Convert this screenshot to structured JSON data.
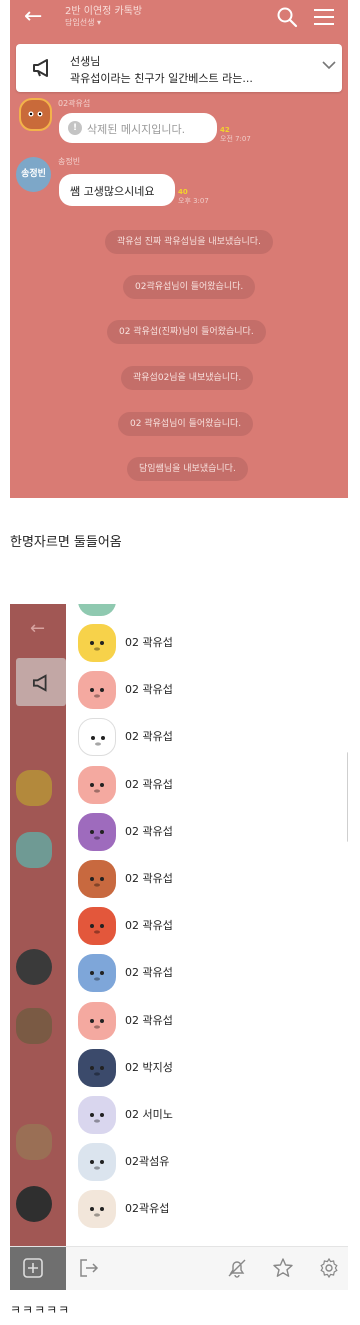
{
  "chat": {
    "title": "2반 이연정 카톡방",
    "subtitle": "담임선생 ▾",
    "notice_title": "선생님",
    "notice_text": "곽유섭이라는 친구가 일간베스트 라는...",
    "messages": [
      {
        "sender": "02곽유섭",
        "text": "삭제된 메시지입니다.",
        "unread": "42",
        "time": "오전 7:07",
        "deleted": true
      },
      {
        "sender": "송정빈",
        "avatar_label": "송정빈",
        "text": "쌤 고생많으시네요",
        "unread": "40",
        "time": "오후 3:07",
        "deleted": false
      }
    ],
    "system_messages": [
      "곽유섭 진짜 곽유섭님을 내보냈습니다.",
      "02곽유섭님이 들어왔습니다.",
      "02 곽유섭(진짜)님이 들어왔습니다.",
      "곽유섭02님을 내보냈습니다.",
      "02 곽유섭님이 들어왔습니다.",
      "담임쌤님을 내보냈습니다."
    ]
  },
  "caption_top": "한명자르면 둘들어옴",
  "members": [
    {
      "name": "02 곽유섭",
      "avatar": "neo-icon",
      "color": "#f7d24a"
    },
    {
      "name": "02 곽유섭",
      "avatar": "apeach-icon",
      "color": "#f4a9a0"
    },
    {
      "name": "02 곽유섭",
      "avatar": "sketch-people-icon",
      "color": "#ffffff"
    },
    {
      "name": "02 곽유섭",
      "avatar": "apeach-icon",
      "color": "#f4a9a0"
    },
    {
      "name": "02 곽유섭",
      "avatar": "muzi-icon",
      "color": "#9e6bbd"
    },
    {
      "name": "02 곽유섭",
      "avatar": "frodo-icon",
      "color": "#c8693f"
    },
    {
      "name": "02 곽유섭",
      "avatar": "fire-ryan-icon",
      "color": "#e3573b"
    },
    {
      "name": "02 곽유섭",
      "avatar": "con-icon",
      "color": "#7ea6d9"
    },
    {
      "name": "02 곽유섭",
      "avatar": "apeach-icon",
      "color": "#f4a9a0"
    },
    {
      "name": "02 박지성",
      "avatar": "tube-icon",
      "color": "#3b4a6b"
    },
    {
      "name": "02 서미노",
      "avatar": "ryan-icon",
      "color": "#d9d6ee"
    },
    {
      "name": "02곽섬유",
      "avatar": "black-hair-icon",
      "color": "#dbe4ee"
    },
    {
      "name": "02곽유섭",
      "avatar": "cat-icon",
      "color": "#f2e6da"
    }
  ],
  "caption_bottom": "ㅋㅋㅋㅋㅋ"
}
